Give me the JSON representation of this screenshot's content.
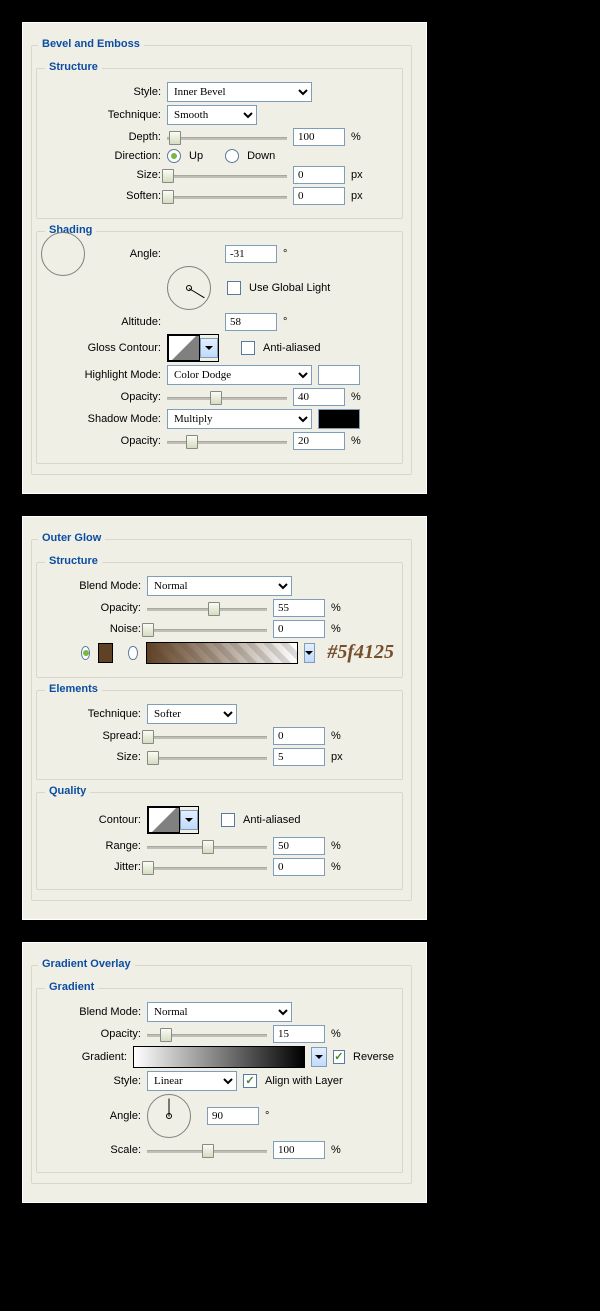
{
  "panels": {
    "bevel": {
      "title": "Bevel and Emboss",
      "structure": {
        "title": "Structure",
        "style_label": "Style:",
        "style_value": "Inner Bevel",
        "technique_label": "Technique:",
        "technique_value": "Smooth",
        "depth_label": "Depth:",
        "depth_value": "100",
        "depth_percent": 0,
        "depth_unit": "%",
        "direction_label": "Direction:",
        "direction_up": "Up",
        "direction_down": "Down",
        "direction_selected": "up",
        "size_label": "Size:",
        "size_value": "0",
        "size_unit": "px",
        "soften_label": "Soften:",
        "soften_value": "0",
        "soften_unit": "px"
      },
      "shading": {
        "title": "Shading",
        "angle_label": "Angle:",
        "angle_value": "-31",
        "angle_unit": "°",
        "use_global_label": "Use Global Light",
        "use_global": false,
        "altitude_label": "Altitude:",
        "altitude_value": "58",
        "altitude_unit": "°",
        "gloss_label": "Gloss Contour:",
        "antialiased_label": "Anti-aliased",
        "antialiased": false,
        "highlight_label": "Highlight Mode:",
        "highlight_value": "Color Dodge",
        "highlight_color": "#ffffff",
        "h_opacity_label": "Opacity:",
        "h_opacity_value": "40",
        "h_opacity_unit": "%",
        "shadow_label": "Shadow Mode:",
        "shadow_value": "Multiply",
        "shadow_color": "#000000",
        "s_opacity_label": "Opacity:",
        "s_opacity_value": "20",
        "s_opacity_unit": "%"
      }
    },
    "glow": {
      "title": "Outer Glow",
      "structure": {
        "title": "Structure",
        "blend_label": "Blend Mode:",
        "blend_value": "Normal",
        "opacity_label": "Opacity:",
        "opacity_value": "55",
        "opacity_unit": "%",
        "noise_label": "Noise:",
        "noise_value": "0",
        "noise_unit": "%",
        "color_hex": "#5f4125",
        "color_selected": "solid"
      },
      "elements": {
        "title": "Elements",
        "technique_label": "Technique:",
        "technique_value": "Softer",
        "spread_label": "Spread:",
        "spread_value": "0",
        "spread_unit": "%",
        "size_label": "Size:",
        "size_value": "5",
        "size_unit": "px"
      },
      "quality": {
        "title": "Quality",
        "contour_label": "Contour:",
        "antialiased_label": "Anti-aliased",
        "antialiased": false,
        "range_label": "Range:",
        "range_value": "50",
        "range_unit": "%",
        "jitter_label": "Jitter:",
        "jitter_value": "0",
        "jitter_unit": "%"
      }
    },
    "gradient": {
      "title": "Gradient Overlay",
      "gradient": {
        "title": "Gradient",
        "blend_label": "Blend Mode:",
        "blend_value": "Normal",
        "opacity_label": "Opacity:",
        "opacity_value": "15",
        "opacity_unit": "%",
        "gradient_label": "Gradient:",
        "reverse_label": "Reverse",
        "reverse": true,
        "style_label": "Style:",
        "style_value": "Linear",
        "align_label": "Align with Layer",
        "align": true,
        "angle_label": "Angle:",
        "angle_value": "90",
        "angle_unit": "°",
        "scale_label": "Scale:",
        "scale_value": "100",
        "scale_unit": "%"
      }
    }
  }
}
